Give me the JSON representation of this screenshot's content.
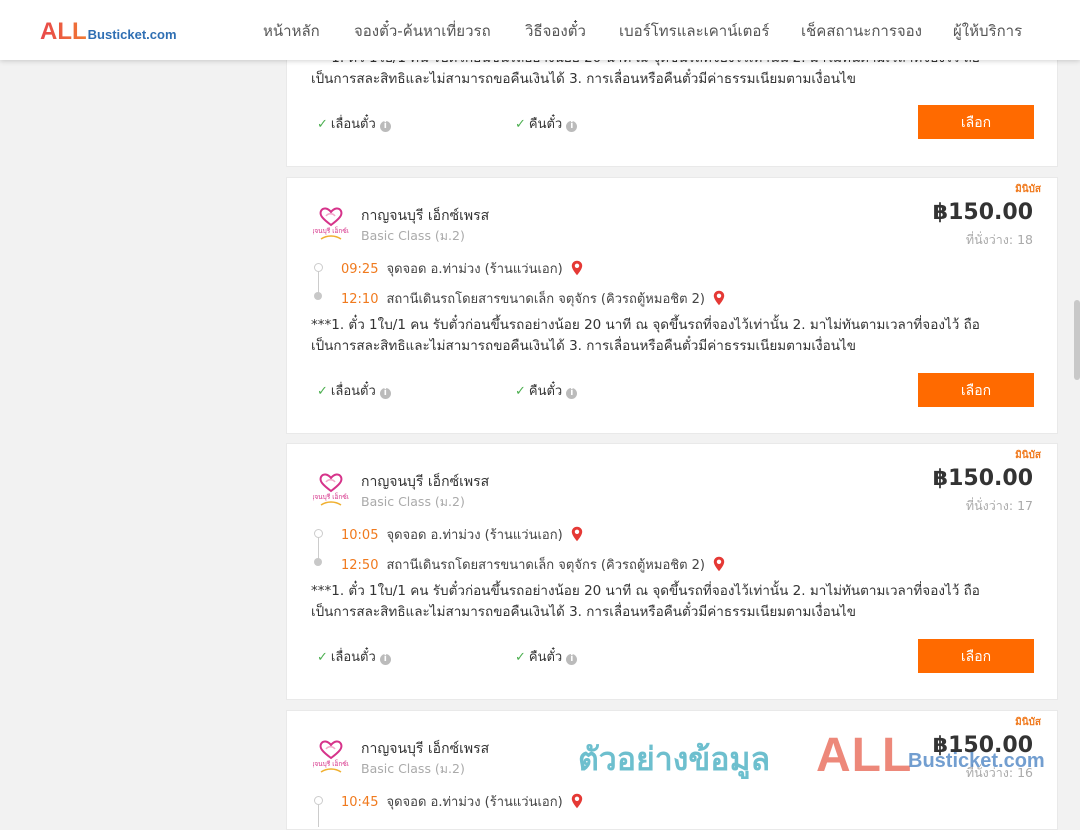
{
  "header": {
    "logo_all": "ALL",
    "logo_rest": "Busticket.com",
    "nav": [
      "หน้าหลัก",
      "จองตั๋ว-ค้นหาเที่ยวรถ",
      "วิธีจองตั๋ว",
      "เบอร์โทรและเคาน์เตอร์",
      "เช็คสถานะการจอง",
      "ผู้ให้บริการ"
    ]
  },
  "common": {
    "note_line1": "***1. ตั๋ว 1ใบ/1 คน รับตั๋วก่อนขึ้นรถอย่างน้อย 20 นาที ณ จุดขึ้นรถที่จองไว้เท่านั้น 2. มาไม่ทันตามเวลาที่จองไว้ ถือ",
    "note_line2": "เป็นการสละสิทธิและไม่สามารถขอคืนเงินได้ 3. การเลื่อนหรือคืนตั๋วมีค่าธรรมเนียมตามเงื่อนไข",
    "opt_reschedule": "เลื่อนตั๋ว",
    "opt_refund": "คืนตั๋ว",
    "select_label": "เลือก",
    "badge": "มินิบัส",
    "seats_label": "ที่นั่งว่าง:"
  },
  "trips": [
    {
      "operator": "กาญจนบุรี เอ็กซ์เพรส",
      "class": "Basic Class (ม.2)",
      "price": "฿150.00",
      "seats": "18",
      "depart_time": "09:25",
      "depart_place": "จุดจอด อ.ท่าม่วง (ร้านแว่นเอก)",
      "arrive_time": "12:10",
      "arrive_place": "สถานีเดินรถโดยสารขนาดเล็ก จตุจักร (คิวรถตู้หมอชิต 2)"
    },
    {
      "operator": "กาญจนบุรี เอ็กซ์เพรส",
      "class": "Basic Class (ม.2)",
      "price": "฿150.00",
      "seats": "17",
      "depart_time": "10:05",
      "depart_place": "จุดจอด อ.ท่าม่วง (ร้านแว่นเอก)",
      "arrive_time": "12:50",
      "arrive_place": "สถานีเดินรถโดยสารขนาดเล็ก จตุจักร (คิวรถตู้หมอชิต 2)"
    },
    {
      "operator": "กาญจนบุรี เอ็กซ์เพรส",
      "class": "Basic Class (ม.2)",
      "price": "฿150.00",
      "seats": "16",
      "depart_time": "10:45",
      "depart_place": "จุดจอด อ.ท่าม่วง (ร้านแว่นเอก)"
    }
  ],
  "operator_logo_text": "กาญจนบุรี เอ็กซ์เพรส",
  "watermark": {
    "text": "ตัวอย่างข้อมูล",
    "all": "ALL",
    "rest": "Busticket.com"
  },
  "colors": {
    "accent": "#ff6a00",
    "time": "#f07a1e",
    "check": "#4caf50",
    "pin": "#e53935"
  }
}
